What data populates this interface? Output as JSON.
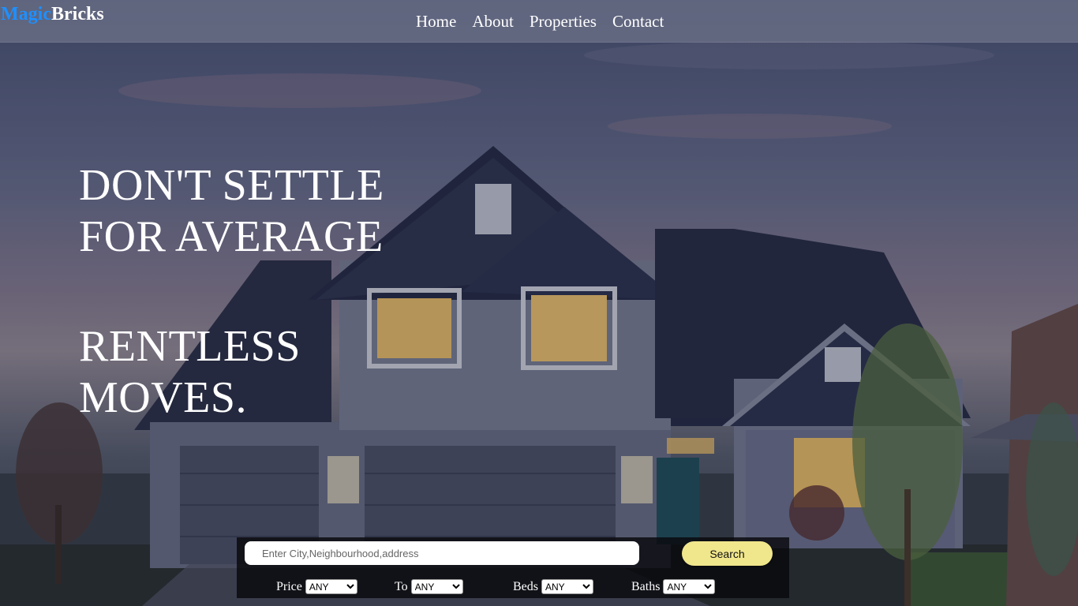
{
  "brand": {
    "part1": "Magic",
    "part2": "Bricks"
  },
  "nav": [
    {
      "label": "Home"
    },
    {
      "label": "About"
    },
    {
      "label": "Properties"
    },
    {
      "label": "Contact"
    }
  ],
  "hero": {
    "line1": "DON'T SETTLE",
    "line2": "FOR AVERAGE",
    "line3": "RENTLESS",
    "line4": "MOVES."
  },
  "search": {
    "placeholder": "Enter City,Neighbourhood,address",
    "value": "",
    "button_label": "Search"
  },
  "filters": [
    {
      "label": "Price",
      "selected": "ANY"
    },
    {
      "label": "To",
      "selected": "ANY"
    },
    {
      "label": "Beds",
      "selected": "ANY"
    },
    {
      "label": "Baths",
      "selected": "ANY"
    }
  ],
  "colors": {
    "brand_accent": "#1e90ff",
    "search_button": "#f0e68c",
    "panel_bg": "#0a0a0e"
  }
}
